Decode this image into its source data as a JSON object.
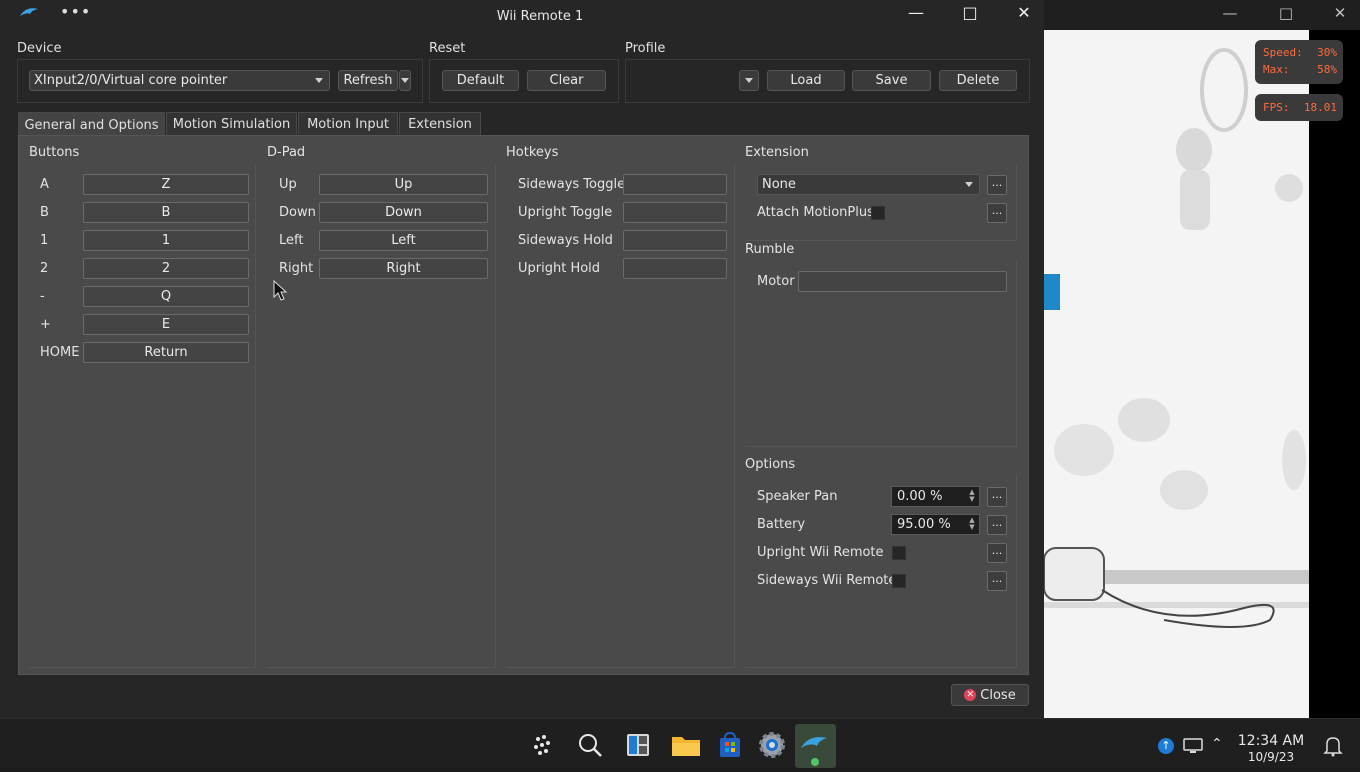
{
  "window": {
    "title": "Wii Remote 1"
  },
  "device": {
    "label": "Device",
    "value": "XInput2/0/Virtual core pointer",
    "refresh_label": "Refresh"
  },
  "reset": {
    "label": "Reset",
    "default_label": "Default",
    "clear_label": "Clear"
  },
  "profile": {
    "label": "Profile",
    "value": "",
    "load_label": "Load",
    "save_label": "Save",
    "delete_label": "Delete"
  },
  "tabs": [
    {
      "label": "General and Options"
    },
    {
      "label": "Motion Simulation"
    },
    {
      "label": "Motion Input"
    },
    {
      "label": "Extension"
    }
  ],
  "buttons": {
    "title": "Buttons",
    "rows": [
      {
        "label": "A",
        "value": "Z"
      },
      {
        "label": "B",
        "value": "B"
      },
      {
        "label": "1",
        "value": "1"
      },
      {
        "label": "2",
        "value": "2"
      },
      {
        "label": "-",
        "value": "Q"
      },
      {
        "label": "+",
        "value": "E"
      },
      {
        "label": "HOME",
        "value": "Return"
      }
    ]
  },
  "dpad": {
    "title": "D-Pad",
    "rows": [
      {
        "label": "Up",
        "value": "Up"
      },
      {
        "label": "Down",
        "value": "Down"
      },
      {
        "label": "Left",
        "value": "Left"
      },
      {
        "label": "Right",
        "value": "Right"
      }
    ]
  },
  "hotkeys": {
    "title": "Hotkeys",
    "rows": [
      {
        "label": "Sideways Toggle",
        "value": ""
      },
      {
        "label": "Upright Toggle",
        "value": ""
      },
      {
        "label": "Sideways Hold",
        "value": ""
      },
      {
        "label": "Upright Hold",
        "value": ""
      }
    ]
  },
  "extension": {
    "title": "Extension",
    "value": "None",
    "attach_motionplus_label": "Attach MotionPlus",
    "more_label": "..."
  },
  "rumble": {
    "title": "Rumble",
    "motor_label": "Motor",
    "motor_value": ""
  },
  "options": {
    "title": "Options",
    "speaker_pan_label": "Speaker Pan",
    "speaker_pan_value": "0.00 %",
    "battery_label": "Battery",
    "battery_value": "95.00 %",
    "upright_label": "Upright Wii Remote",
    "sideways_label": "Sideways Wii Remote"
  },
  "close_label": "Close",
  "osd": {
    "speed_label": "Speed:",
    "speed_value": "30%",
    "max_label": "Max:",
    "max_value": "58%",
    "fps_label": "FPS:",
    "fps_value": "18.01"
  },
  "taskbar": {
    "time": "12:34 AM",
    "date": "10/9/23"
  },
  "colors": {
    "osd_text": "#ff6a3d",
    "close_icon": "#e0455a",
    "accent": "#1e7bd6"
  }
}
